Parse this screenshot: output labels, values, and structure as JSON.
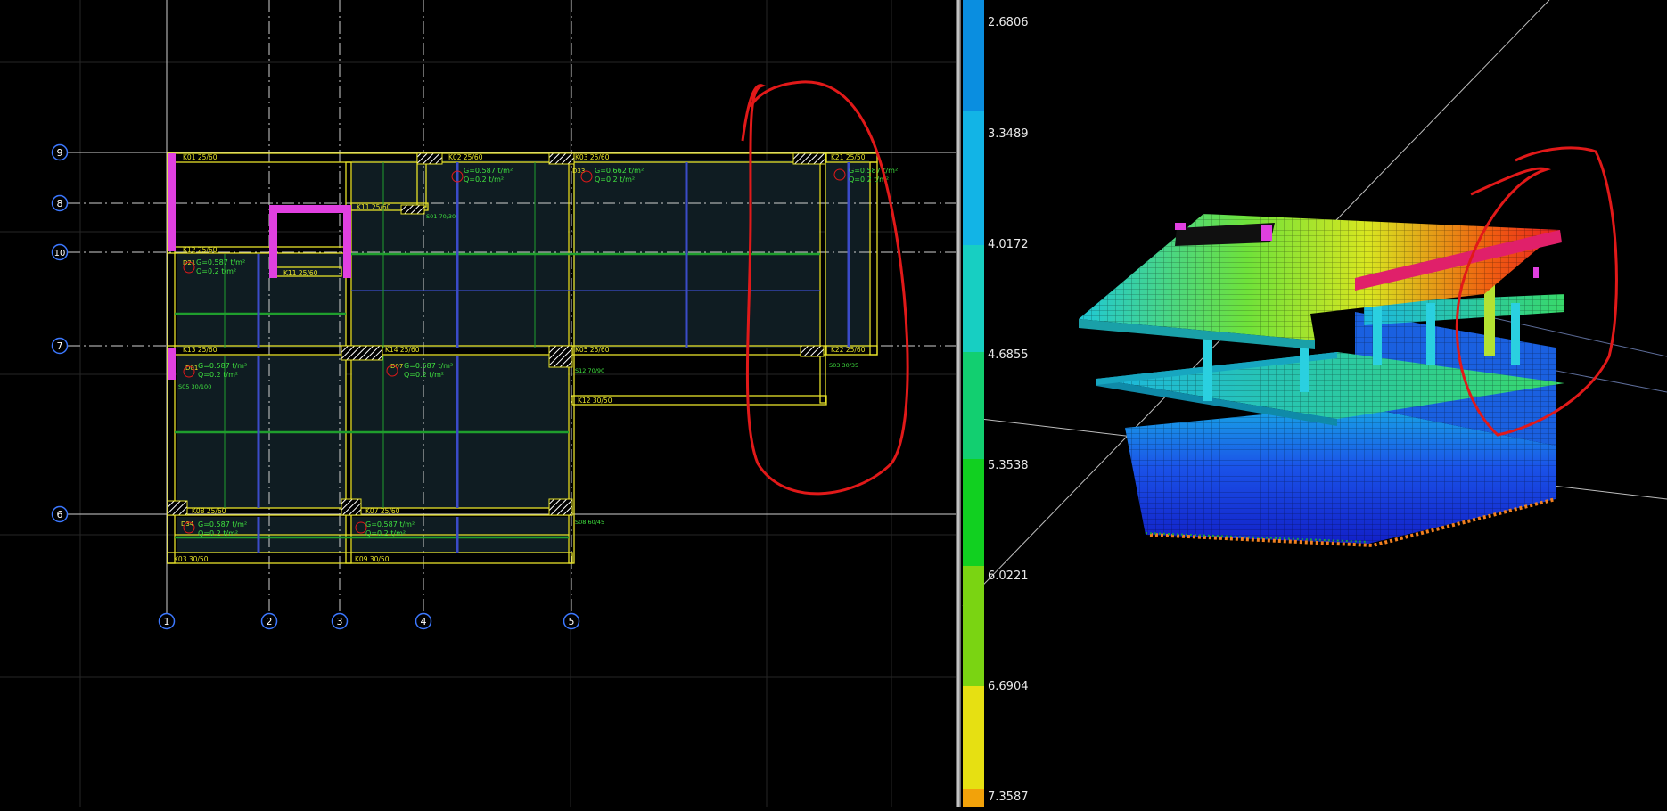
{
  "plan": {
    "grid_rows": [
      "9",
      "8",
      "10",
      "7",
      "6"
    ],
    "grid_cols": [
      "1",
      "2",
      "3",
      "4",
      "5"
    ],
    "beams": [
      "K01  25/60",
      "K02  25/60",
      "K03  25/60",
      "K21  25/50",
      "K12  25/60",
      "K11  25/60",
      "K11  25/60",
      "K13  25/60",
      "K14  25/60",
      "K05  25/60",
      "K22  25/60",
      "K12  30/50",
      "K08  25/60",
      "K07  25/60",
      "K03  30/50",
      "K09  30/50"
    ],
    "slab_loads": {
      "g_std": "G=0.587 t/m²",
      "q_std": "Q=0.2 t/m²",
      "g_alt": "G=0.662 t/m²"
    },
    "slab_tags": [
      "D21",
      "D01",
      "D07",
      "D33",
      "D34"
    ],
    "column_labels": [
      "S01 70/30",
      "S12 70/90",
      "S05 30/100",
      "S08 60/45",
      "S03 30/35"
    ]
  },
  "legend": {
    "values": [
      "2.6806",
      "3.3489",
      "4.0172",
      "4.6855",
      "5.3538",
      "6.0221",
      "6.6904",
      "7.3587"
    ],
    "colors": [
      "#0a8ee0",
      "#12b4e6",
      "#17cfc2",
      "#12cf70",
      "#11d020",
      "#7ad412",
      "#e6e012",
      "#f2a20a"
    ]
  },
  "colors": {
    "slab_outline": "#e6e22a",
    "wall": "#e040e0",
    "grid_line": "#d8d8d8",
    "bubble": "#3c78ff",
    "annotation": "#e11919",
    "load_text": "#3fe13f"
  }
}
